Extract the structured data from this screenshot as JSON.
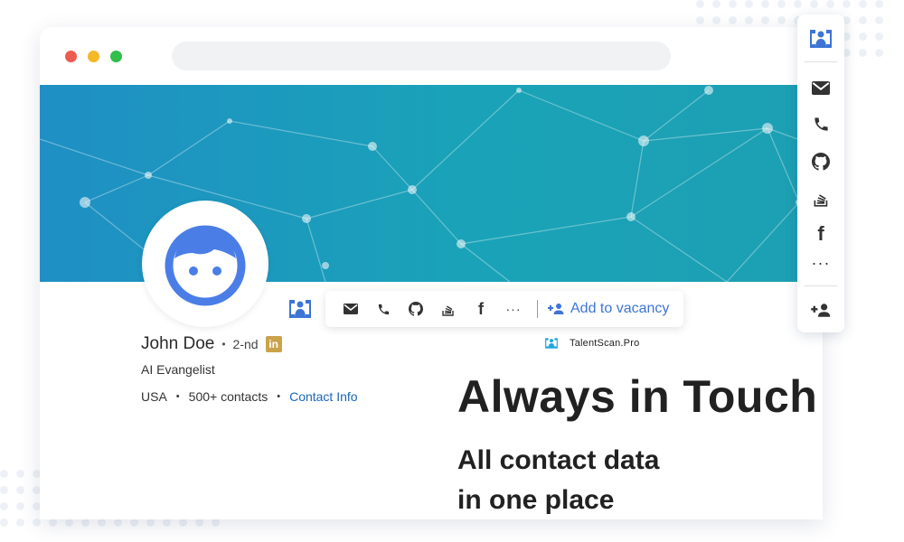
{
  "window": {
    "traffic_lights": [
      "close",
      "minimize",
      "maximize"
    ]
  },
  "profile": {
    "name": "John Doe",
    "separator": "•",
    "degree": "2-nd",
    "linkedin_badge": "in",
    "headline": "AI Evangelist",
    "location": "USA",
    "contacts": "500+ contacts",
    "contact_info_label": "Contact Info"
  },
  "toolbar": {
    "icons": [
      "email-icon",
      "phone-icon",
      "github-icon",
      "stackoverflow-icon",
      "facebook-icon",
      "more-icon"
    ],
    "more_label": "···",
    "facebook_label": "f",
    "add_vacancy_label": "Add to vacancy"
  },
  "brand": {
    "name": "TalentScan.Pro"
  },
  "hero": {
    "title": "Always in Touch",
    "subtitle_line1": "All contact data",
    "subtitle_line2": "in one place"
  },
  "sidepanel": {
    "items": [
      "logo-icon",
      "email-icon",
      "phone-icon",
      "github-icon",
      "stackoverflow-icon",
      "facebook-icon",
      "more-icon",
      "add-person-icon"
    ],
    "facebook_label": "f",
    "more_label": "···"
  },
  "colors": {
    "banner_start": "#1f8fc4",
    "banner_end": "#1d9fb3",
    "accent_blue": "#3d74d6",
    "link_blue": "#1a66b8",
    "avatar_blue": "#4a7ee6",
    "traffic_red": "#ee5b4f",
    "traffic_yellow": "#f5b829",
    "traffic_green": "#2fbf4a"
  }
}
